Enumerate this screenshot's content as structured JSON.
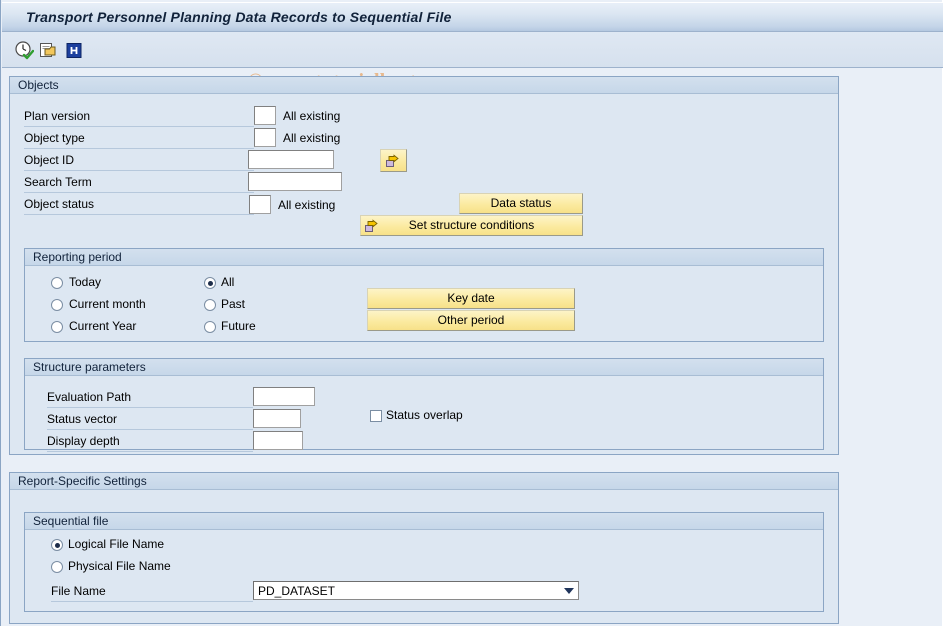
{
  "window": {
    "title": "Transport Personnel Planning Data Records to Sequential File",
    "watermark": "© www.tutorialkart.com"
  },
  "toolbar": {
    "items": [
      {
        "name": "execute-icon",
        "tooltip": "Execute"
      },
      {
        "name": "copy-icon",
        "tooltip": "Get Variant"
      },
      {
        "name": "info-icon",
        "tooltip": "Help"
      }
    ]
  },
  "objects": {
    "header": "Objects",
    "fields": [
      {
        "label": "Plan version",
        "value": "",
        "side": "All existing"
      },
      {
        "label": "Object type",
        "value": "",
        "side": "All existing"
      },
      {
        "label": "Object ID",
        "value": "",
        "side": ""
      },
      {
        "label": "Search Term",
        "value": "",
        "side": ""
      },
      {
        "label": "Object status",
        "value": "",
        "side": "All existing"
      }
    ],
    "multiple_selection_button": "",
    "data_status_button": "Data status",
    "set_structure_conditions_button": "Set structure conditions"
  },
  "reporting_period": {
    "header": "Reporting period",
    "left_options": [
      {
        "label": "Today",
        "selected": false
      },
      {
        "label": "Current month",
        "selected": false
      },
      {
        "label": "Current Year",
        "selected": false
      }
    ],
    "right_options": [
      {
        "label": "All",
        "selected": true
      },
      {
        "label": "Past",
        "selected": false
      },
      {
        "label": "Future",
        "selected": false
      }
    ],
    "key_date_button": "Key date",
    "other_period_button": "Other period"
  },
  "structure_parameters": {
    "header": "Structure parameters",
    "fields": [
      {
        "label": "Evaluation Path",
        "value": ""
      },
      {
        "label": "Status vector",
        "value": ""
      },
      {
        "label": "Display depth",
        "value": ""
      }
    ],
    "status_overlap": {
      "label": "Status overlap",
      "checked": false
    }
  },
  "report_specific_settings": {
    "header": "Report-Specific Settings",
    "sequential_file": {
      "header": "Sequential file",
      "options": [
        {
          "label": "Logical File Name",
          "selected": true
        },
        {
          "label": "Physical File Name",
          "selected": false
        }
      ],
      "file_name_label": "File Name",
      "file_name_value": "PD_DATASET"
    }
  },
  "colors": {
    "titlebar_top": "#e8eff8",
    "titlebar_bottom": "#b4c8e0",
    "panel_bg": "#dde7f2",
    "page_bg": "#e9eff7",
    "button_yellow": "#fbeaa0",
    "watermark": "#e8b07c",
    "border": "#8ba5c4"
  }
}
